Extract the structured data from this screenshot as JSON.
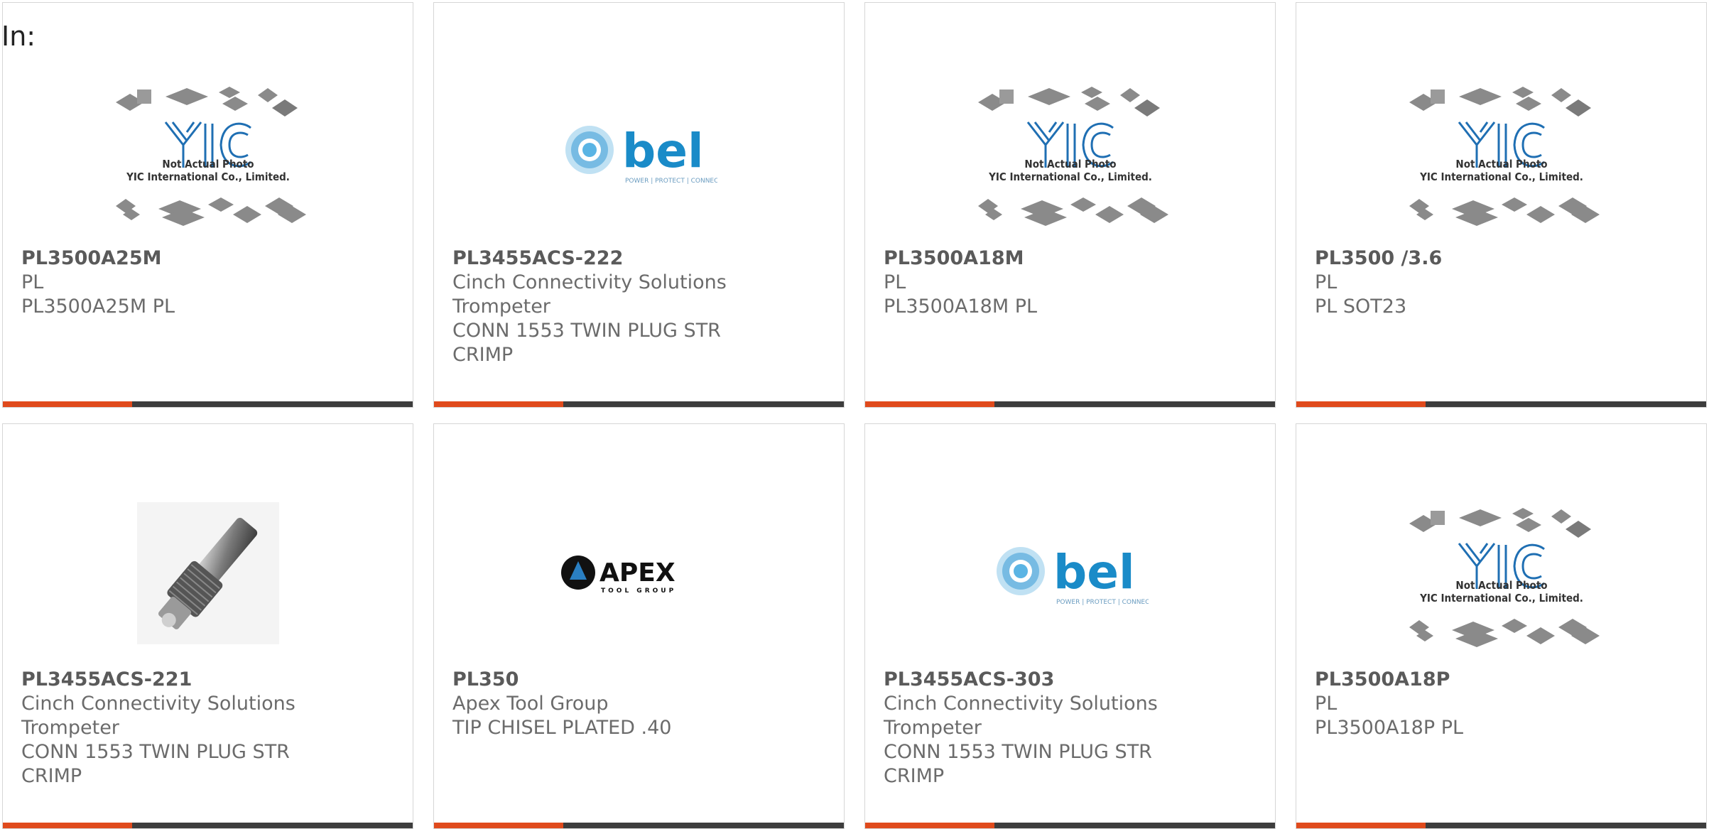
{
  "page": {
    "label": "In:"
  },
  "placeholder_caption": {
    "line1": "Not Actual Photo",
    "line2": "YIC International Co., Limited."
  },
  "brand_logos": {
    "bel": {
      "text": "bel",
      "tagline": "POWER | PROTECT | CONNECT",
      "color": "#1a8bc8"
    },
    "apex": {
      "text": "APEX",
      "tagline": "TOOL GROUP"
    }
  },
  "colors": {
    "accent": "#e04a1c",
    "bar": "#3d3d3d",
    "text": "#6b6b6b",
    "title": "#5a5a5a"
  },
  "cards": [
    {
      "image": "yic-placeholder",
      "part_number": "PL3500A25M",
      "lines": [
        "PL",
        "PL3500A25M PL"
      ]
    },
    {
      "image": "bel-logo",
      "part_number": "PL3455ACS-222",
      "lines": [
        "Cinch Connectivity Solutions",
        "Trompeter",
        "CONN 1553 TWIN PLUG STR",
        "CRIMP"
      ]
    },
    {
      "image": "yic-placeholder",
      "part_number": "PL3500A18M",
      "lines": [
        "PL",
        "PL3500A18M PL"
      ]
    },
    {
      "image": "yic-placeholder",
      "part_number": "PL3500 /3.6",
      "lines": [
        "PL",
        "PL SOT23"
      ]
    },
    {
      "image": "connector-photo",
      "part_number": "PL3455ACS-221",
      "lines": [
        "Cinch Connectivity Solutions",
        "Trompeter",
        "CONN 1553 TWIN PLUG STR",
        "CRIMP"
      ]
    },
    {
      "image": "apex-logo",
      "part_number": "PL350",
      "lines": [
        "Apex Tool Group",
        "TIP CHISEL PLATED .40"
      ]
    },
    {
      "image": "bel-logo",
      "part_number": "PL3455ACS-303",
      "lines": [
        "Cinch Connectivity Solutions",
        "Trompeter",
        "CONN 1553 TWIN PLUG STR",
        "CRIMP"
      ]
    },
    {
      "image": "yic-placeholder",
      "part_number": "PL3500A18P",
      "lines": [
        "PL",
        "PL3500A18P PL"
      ]
    }
  ]
}
